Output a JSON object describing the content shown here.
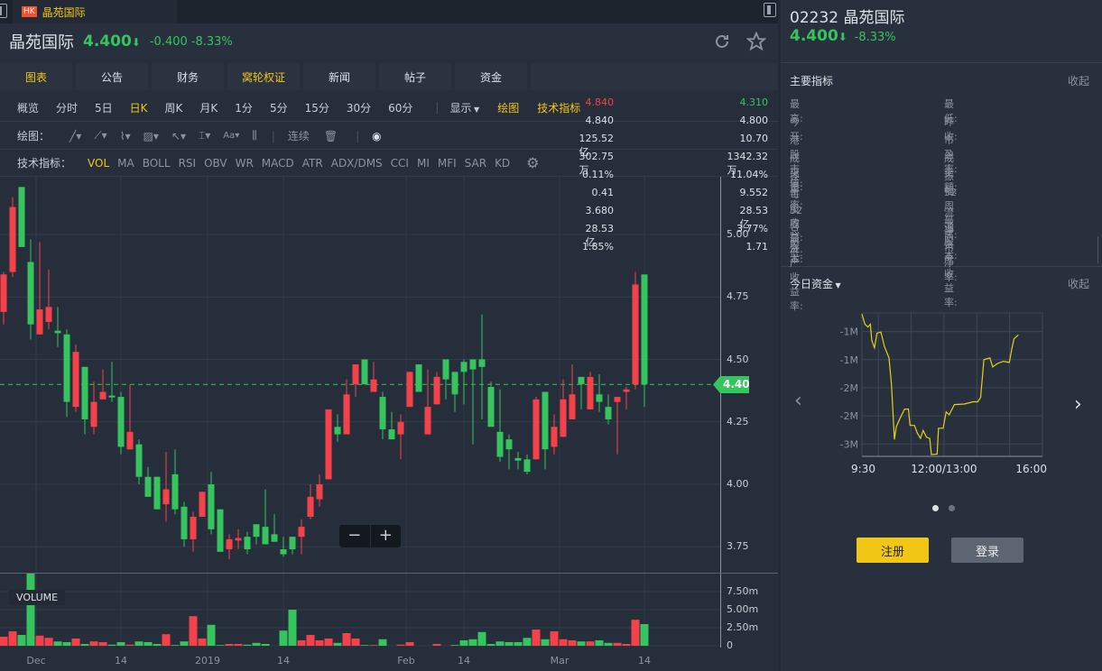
{
  "tabbar": {
    "market": "HK",
    "title": "晶苑国际"
  },
  "header": {
    "name": "晶苑国际",
    "price": "4.400",
    "arrow": "⬇",
    "change": "-0.400",
    "change_pct": "-8.33%"
  },
  "nav": [
    "图表",
    "公告",
    "财务",
    "窝轮权证",
    "新闻",
    "帖子",
    "资金",
    ""
  ],
  "periods": [
    "概览",
    "分时",
    "5日",
    "日K",
    "周K",
    "月K",
    "1分",
    "5分",
    "15分",
    "30分",
    "60分"
  ],
  "period_active": "日K",
  "display_label": "显示",
  "draw_label": "绘图",
  "indicators_label": "技术指标",
  "drawing": {
    "label": "绘图：",
    "continuous": "连续"
  },
  "indicators": {
    "label": "技术指标：",
    "items": [
      "VOL",
      "MA",
      "BOLL",
      "RSI",
      "OBV",
      "WR",
      "MACD",
      "ATR",
      "ADX/DMS",
      "CCI",
      "MI",
      "MFI",
      "SAR",
      "KD"
    ]
  },
  "zoom_ctrl": {
    "minus": "−",
    "plus": "+"
  },
  "price_tag": "4.40",
  "volume_label": "VOLUME",
  "colors": {
    "up": "#f5424a",
    "down": "#35c45d",
    "accent": "#f2c615"
  },
  "chart_data": {
    "type": "candlestick",
    "y_ticks": [
      "5.00",
      "4.75",
      "4.50",
      "4.25",
      "4.00",
      "3.75"
    ],
    "ylim": [
      3.66,
      5.23
    ],
    "x_labels": [
      "Dec",
      "14",
      "2019",
      "14",
      "Feb",
      "14",
      "Mar",
      "14"
    ],
    "x_label_index": [
      3.6,
      13,
      22.6,
      31,
      44.6,
      51,
      61.6,
      71
    ],
    "last_price": 4.4,
    "ohlc": [
      [
        4.69,
        4.85,
        4.64,
        4.84
      ],
      [
        4.85,
        5.15,
        4.83,
        5.11
      ],
      [
        5.19,
        5.19,
        4.95,
        4.95
      ],
      [
        4.89,
        4.98,
        4.58,
        4.64
      ],
      [
        4.6,
        4.97,
        4.6,
        4.7
      ],
      [
        4.65,
        4.86,
        4.62,
        4.71
      ],
      [
        4.615,
        4.71,
        4.55,
        4.605
      ],
      [
        4.6,
        4.62,
        4.27,
        4.33
      ],
      [
        4.31,
        4.56,
        4.29,
        4.53
      ],
      [
        4.47,
        4.47,
        4.2,
        4.26
      ],
      [
        4.23,
        4.41,
        4.2,
        4.33
      ],
      [
        4.34,
        4.46,
        4.34,
        4.37
      ],
      [
        4.355,
        4.49,
        4.33,
        4.35
      ],
      [
        4.35,
        4.37,
        4.12,
        4.15
      ],
      [
        4.14,
        4.4,
        4.14,
        4.21
      ],
      [
        4.16,
        4.18,
        4.0,
        4.03
      ],
      [
        4.03,
        4.07,
        3.95,
        3.95
      ],
      [
        4.03,
        4.03,
        3.9,
        3.9
      ],
      [
        3.92,
        4.13,
        3.85,
        3.98
      ],
      [
        4.04,
        4.14,
        3.88,
        3.9
      ],
      [
        3.91,
        3.93,
        3.75,
        3.78
      ],
      [
        3.78,
        3.89,
        3.73,
        3.87
      ],
      [
        3.87,
        3.97,
        3.87,
        3.97
      ],
      [
        4.0,
        4.05,
        3.8,
        3.82
      ],
      [
        3.9,
        3.9,
        3.73,
        3.73
      ],
      [
        3.74,
        3.8,
        3.7,
        3.78
      ],
      [
        3.775,
        3.82,
        3.74,
        3.785
      ],
      [
        3.79,
        3.81,
        3.72,
        3.74
      ],
      [
        3.84,
        3.84,
        3.76,
        3.79
      ],
      [
        3.83,
        3.98,
        3.76,
        3.76
      ],
      [
        3.8,
        3.88,
        3.77,
        3.77
      ],
      [
        3.74,
        3.79,
        3.71,
        3.72
      ],
      [
        3.79,
        3.79,
        3.72,
        3.74
      ],
      [
        3.79,
        3.86,
        3.72,
        3.83
      ],
      [
        3.87,
        4.0,
        3.86,
        3.95
      ],
      [
        3.94,
        4.04,
        3.91,
        4.0
      ],
      [
        4.02,
        4.3,
        4.02,
        4.3
      ],
      [
        4.23,
        4.28,
        4.17,
        4.2
      ],
      [
        4.2,
        4.42,
        4.2,
        4.36
      ],
      [
        4.4,
        4.48,
        4.35,
        4.48
      ],
      [
        4.5,
        4.5,
        4.4,
        4.4
      ],
      [
        4.37,
        4.49,
        4.37,
        4.42
      ],
      [
        4.35,
        4.37,
        4.18,
        4.22
      ],
      [
        4.22,
        4.29,
        4.18,
        4.18
      ],
      [
        4.2,
        4.28,
        4.1,
        4.25
      ],
      [
        4.31,
        4.45,
        4.31,
        4.45
      ],
      [
        4.48,
        4.48,
        4.37,
        4.37
      ],
      [
        4.2,
        4.46,
        4.2,
        4.31
      ],
      [
        4.32,
        4.45,
        4.32,
        4.43
      ],
      [
        4.5,
        4.5,
        4.34,
        4.42
      ],
      [
        4.45,
        4.45,
        4.29,
        4.36
      ],
      [
        4.49,
        4.5,
        4.32,
        4.45
      ],
      [
        4.5,
        4.5,
        4.16,
        4.46
      ],
      [
        4.5,
        4.68,
        4.26,
        4.47
      ],
      [
        4.39,
        4.41,
        4.23,
        4.23
      ],
      [
        4.21,
        4.38,
        4.09,
        4.11
      ],
      [
        4.18,
        4.2,
        4.06,
        4.14
      ],
      [
        4.105,
        4.13,
        4.06,
        4.095
      ],
      [
        4.1,
        4.12,
        4.04,
        4.05
      ],
      [
        4.1,
        4.35,
        4.1,
        4.34
      ],
      [
        4.37,
        4.37,
        4.06,
        4.14
      ],
      [
        4.15,
        4.28,
        4.12,
        4.23
      ],
      [
        4.19,
        4.42,
        4.19,
        4.34
      ],
      [
        4.26,
        4.48,
        4.26,
        4.36
      ],
      [
        4.43,
        4.43,
        4.3,
        4.4
      ],
      [
        4.3,
        4.45,
        4.3,
        4.43
      ],
      [
        4.36,
        4.44,
        4.29,
        4.33
      ],
      [
        4.31,
        4.36,
        4.24,
        4.26
      ],
      [
        4.33,
        4.35,
        4.12,
        4.35
      ],
      [
        4.37,
        4.39,
        4.3,
        4.38
      ],
      [
        4.4,
        4.85,
        4.38,
        4.8
      ],
      [
        4.84,
        4.84,
        4.31,
        4.4
      ]
    ],
    "volume_m": [
      1.25,
      2.0,
      1.5,
      10,
      1.4,
      1.1,
      0.6,
      0.5,
      1.0,
      0.25,
      0.6,
      0.5,
      0.15,
      0.5,
      0.15,
      0.6,
      0.5,
      0.25,
      1.6,
      0.1,
      0.6,
      4.1,
      1.0,
      2.9,
      0.1,
      0.25,
      0.25,
      0.15,
      0.4,
      0.25,
      0,
      2.1,
      5.0,
      0.75,
      1.5,
      0.75,
      1.0,
      0.4,
      1.75,
      1.0,
      0.1,
      0.1,
      0.9,
      0,
      0.15,
      0.5,
      0,
      0,
      0.25,
      0,
      0.1,
      0.75,
      0.9,
      1.9,
      0.25,
      0.6,
      0.5,
      0.5,
      1.1,
      2.25,
      0.9,
      2.0,
      0.9,
      0.75,
      0.6,
      0.6,
      0.75,
      0.4,
      0.4,
      0.25,
      3.6,
      3.0
    ],
    "volume_ticks": [
      "7.50m",
      "5.00m",
      "2.50m",
      "0"
    ],
    "volume_tick_values": [
      7.5,
      5,
      2.5,
      0
    ]
  },
  "right": {
    "title": "02232 晶苑国际",
    "price": "4.400",
    "arrow": "⬇",
    "change_pct": "-8.33%",
    "metrics_title": "主要指标",
    "collapse": "收起",
    "metrics": [
      [
        "最高:",
        "4.840",
        "最低:",
        "4.310"
      ],
      [
        "今开:",
        "4.840",
        "昨收:",
        "4.800"
      ],
      [
        "港股市值:",
        "125.52亿",
        "市盈率:",
        "10.70"
      ],
      [
        "成交量:",
        "302.75万",
        "成交额:",
        "1342.32万"
      ],
      [
        "换手率:",
        "0.11%",
        "振幅:",
        "11.04%"
      ],
      [
        "每股收益:",
        "0.41",
        "52周最高:",
        "9.552"
      ],
      [
        "52周最低:",
        "3.680",
        "流通股本:",
        "28.53亿"
      ],
      [
        "总股本:",
        "28.53亿",
        "净资产收益率:",
        "3.77%"
      ],
      [
        "资产收益率:",
        "1.85%",
        "市净率:",
        "1.71"
      ]
    ],
    "funds_title": "今日资金",
    "funds_collapse": "收起",
    "register": "注册",
    "login": "登录"
  },
  "fund_chart": {
    "type": "line",
    "y_labels": [
      "-1M",
      "-1M",
      "-2M",
      "-2M",
      "-3M"
    ],
    "y_label_values": [
      -1,
      -1.5,
      -2,
      -2.5,
      -3
    ],
    "ylim": [
      -3.22,
      -0.67
    ],
    "x_labels": [
      "9:30",
      "12:00/13:00",
      "16:00"
    ],
    "xlim": [
      0,
      330
    ],
    "points": [
      [
        0,
        -0.69
      ],
      [
        5.5,
        -0.87
      ],
      [
        11,
        -0.92
      ],
      [
        15.4,
        -0.87
      ],
      [
        18,
        -1.16
      ],
      [
        23,
        -1.29
      ],
      [
        27.5,
        -1.03
      ],
      [
        34.7,
        -1.01
      ],
      [
        41,
        -1.26
      ],
      [
        49.5,
        -1.47
      ],
      [
        54,
        -1.94
      ],
      [
        59.4,
        -2.92
      ],
      [
        63,
        -2.69
      ],
      [
        68.8,
        -2.56
      ],
      [
        74,
        -2.46
      ],
      [
        78,
        -2.38
      ],
      [
        85,
        -2.38
      ],
      [
        88,
        -2.67
      ],
      [
        96,
        -2.67
      ],
      [
        101,
        -2.8
      ],
      [
        107,
        -2.9
      ],
      [
        112,
        -2.76
      ],
      [
        118,
        -2.88
      ],
      [
        124,
        -2.9
      ],
      [
        127,
        -3.19
      ],
      [
        137.5,
        -3.18
      ],
      [
        140,
        -2.72
      ],
      [
        148.5,
        -2.72
      ],
      [
        154,
        -2.43
      ],
      [
        159.5,
        -2.48
      ],
      [
        169,
        -2.3
      ],
      [
        187,
        -2.29
      ],
      [
        203.5,
        -2.25
      ],
      [
        211.75,
        -2.25
      ],
      [
        217,
        -2.17
      ],
      [
        223,
        -1.5
      ],
      [
        234,
        -1.47
      ],
      [
        239,
        -1.63
      ],
      [
        247.5,
        -1.57
      ],
      [
        258.5,
        -1.53
      ],
      [
        269.5,
        -1.55
      ],
      [
        274,
        -1.31
      ],
      [
        278,
        -1.13
      ],
      [
        286,
        -1.06
      ]
    ]
  }
}
